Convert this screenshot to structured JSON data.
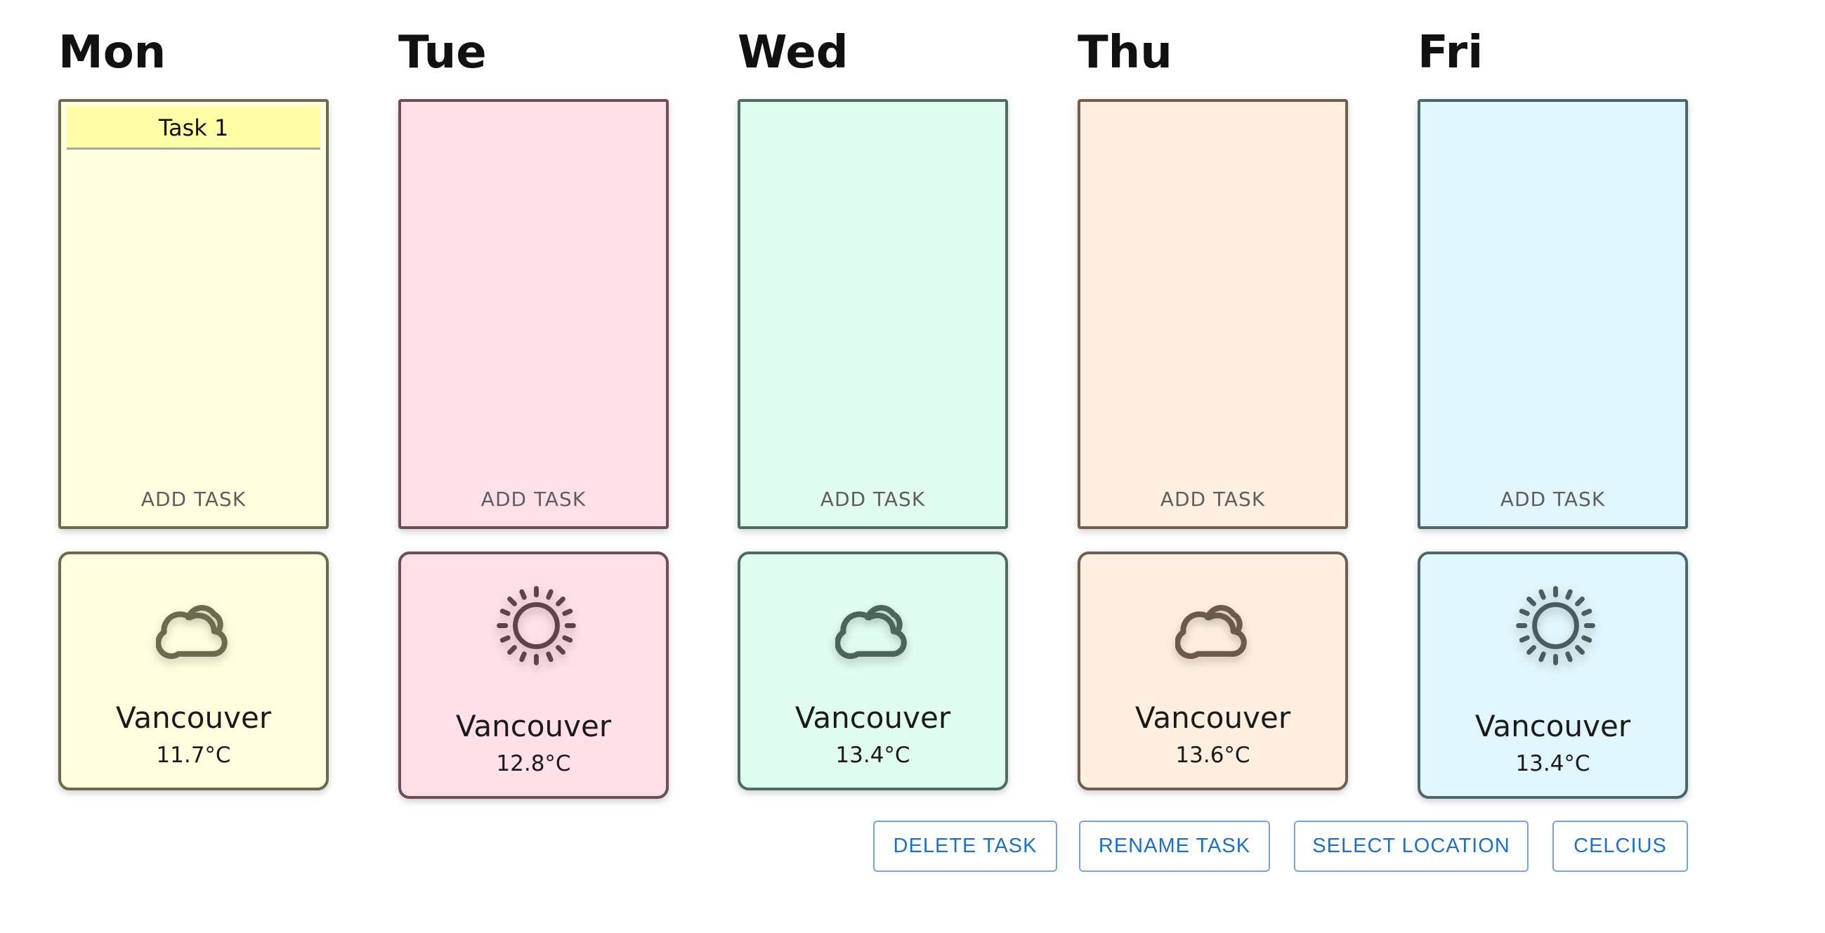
{
  "days": [
    {
      "name": "Mon",
      "board_bg": "#ffffe0",
      "border": "#6c6a4c",
      "icon_color": "#6b6b4d",
      "tasks": [
        "Task 1"
      ],
      "add_task_label": "ADD TASK",
      "weather": {
        "icon": "cloud-icon",
        "city": "Vancouver",
        "temp": "11.7°C"
      }
    },
    {
      "name": "Tue",
      "board_bg": "#ffe0e8",
      "border": "#6e4d55",
      "icon_color": "#5d4448",
      "tasks": [],
      "add_task_label": "ADD TASK",
      "weather": {
        "icon": "sun-icon",
        "city": "Vancouver",
        "temp": "12.8°C"
      }
    },
    {
      "name": "Wed",
      "board_bg": "#e0fdf0",
      "border": "#4e6d62",
      "icon_color": "#4d6559",
      "tasks": [],
      "add_task_label": "ADD TASK",
      "weather": {
        "icon": "cloud-icon",
        "city": "Vancouver",
        "temp": "13.4°C"
      }
    },
    {
      "name": "Thu",
      "board_bg": "#ffefe0",
      "border": "#6e5f51",
      "icon_color": "#6b5a4b",
      "tasks": [],
      "add_task_label": "ADD TASK",
      "weather": {
        "icon": "cloud-icon",
        "city": "Vancouver",
        "temp": "13.6°C"
      }
    },
    {
      "name": "Fri",
      "board_bg": "#e0f6fc",
      "border": "#4b666d",
      "icon_color": "#4a5d5e",
      "tasks": [],
      "add_task_label": "ADD TASK",
      "weather": {
        "icon": "sun-icon",
        "city": "Vancouver",
        "temp": "13.4°C"
      }
    }
  ],
  "actions": {
    "delete_task": "DELETE TASK",
    "rename_task": "RENAME TASK",
    "select_location": "SELECT LOCATION",
    "units": "CELCIUS"
  },
  "colors": {
    "button_text": "#1f6fc2",
    "button_border": "#7ba3d6",
    "task_highlight": "#ffffa8"
  }
}
